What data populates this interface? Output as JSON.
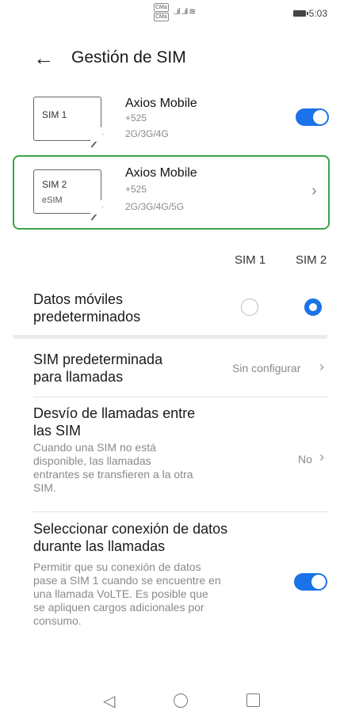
{
  "status_bar": {
    "sim_tags": [
      "CMa",
      "CMa"
    ],
    "signal": "..ıl ..ıl ≋",
    "time": "5:03"
  },
  "header": {
    "title": "Gestión de SIM"
  },
  "sims": [
    {
      "icon_label": "SIM 1",
      "icon_sub": "",
      "carrier": "Axios Mobile",
      "number": "+525",
      "networks": "2G/3G/4G",
      "enabled": true
    },
    {
      "icon_label": "SIM 2",
      "icon_sub": "eSIM",
      "carrier": "Axios Mobile",
      "number": "+525",
      "networks": "2G/3G/4G/5G"
    }
  ],
  "columns": {
    "sim1": "SIM 1",
    "sim2": "SIM 2"
  },
  "default_data": {
    "title_line1": "Datos móviles",
    "title_line2": "predeterminados",
    "selected": "SIM 2"
  },
  "default_calls": {
    "title_line1": "SIM predeterminada",
    "title_line2": "para llamadas",
    "value": "Sin configurar"
  },
  "call_forwarding": {
    "title_line1": "Desvío de llamadas entre",
    "title_line2": "las SIM",
    "desc_line1": "Cuando una SIM no está",
    "desc_line2": "disponible, las llamadas",
    "desc_line3": "entrantes se transfieren a la otra",
    "desc_line4": "SIM.",
    "value": "No"
  },
  "data_during_calls": {
    "title_line1": "Seleccionar conexión de datos",
    "title_line2": "durante las llamadas",
    "desc_line1": "Permitir que su conexión de datos",
    "desc_line2": "pase a SIM 1 cuando se encuentre en",
    "desc_line3": "una llamada VoLTE. Es posible que",
    "desc_line4": "se apliquen cargos adicionales por",
    "desc_line5": "consumo.",
    "enabled": true
  },
  "colors": {
    "accent": "#1a73e8",
    "selected_border": "#3da24a"
  }
}
